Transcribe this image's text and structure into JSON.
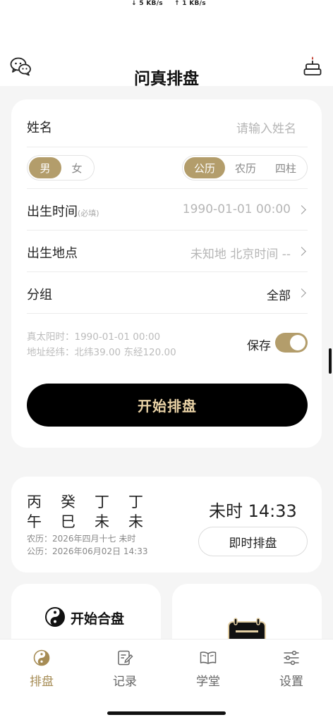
{
  "status_bar": {
    "down_speed": "↓ 5 KB/s",
    "up_speed": "↑ 1 KB/s"
  },
  "nav": {
    "title": "问真排盘",
    "left_icon": "wechat-icon",
    "right_icon": "cake-icon"
  },
  "form": {
    "name_label": "姓名",
    "name_placeholder": "请输入姓名",
    "gender": {
      "options": [
        "男",
        "女"
      ],
      "selected": "男"
    },
    "calendar": {
      "options": [
        "公历",
        "农历",
        "四柱"
      ],
      "selected": "公历"
    },
    "birth_time_label": "出生时间",
    "birth_time_required": "(必填)",
    "birth_time_value": "1990-01-01 00:00",
    "birth_place_label": "出生地点",
    "birth_place_value": "未知地 北京时间 --",
    "group_label": "分组",
    "group_value": "全部",
    "true_solar_time": "真太阳时：1990-01-01 00:00",
    "coordinates": "地址经纬：北纬39.00 东经120.00",
    "save_label": "保存",
    "save_enabled": true,
    "start_button": "开始排盘"
  },
  "time_card": {
    "stems": [
      "丙",
      "癸",
      "丁",
      "丁"
    ],
    "branches": [
      "午",
      "巳",
      "未",
      "未"
    ],
    "lunar": "农历：2026年四月十七 未时",
    "solar": "公历：2026年06月02日 14:33",
    "current_time": "未时 14:33",
    "instant_button": "即时排盘"
  },
  "features": {
    "compat_label": "开始合盘"
  },
  "tabs": [
    {
      "label": "排盘",
      "icon": "yin-yang-icon",
      "active": true
    },
    {
      "label": "记录",
      "icon": "edit-record-icon",
      "active": false
    },
    {
      "label": "学堂",
      "icon": "book-icon",
      "active": false
    },
    {
      "label": "设置",
      "icon": "sliders-icon",
      "active": false
    }
  ],
  "colors": {
    "accent": "#b39d6b",
    "accent_text": "#a68c55",
    "button_text": "#e9d2a6"
  }
}
